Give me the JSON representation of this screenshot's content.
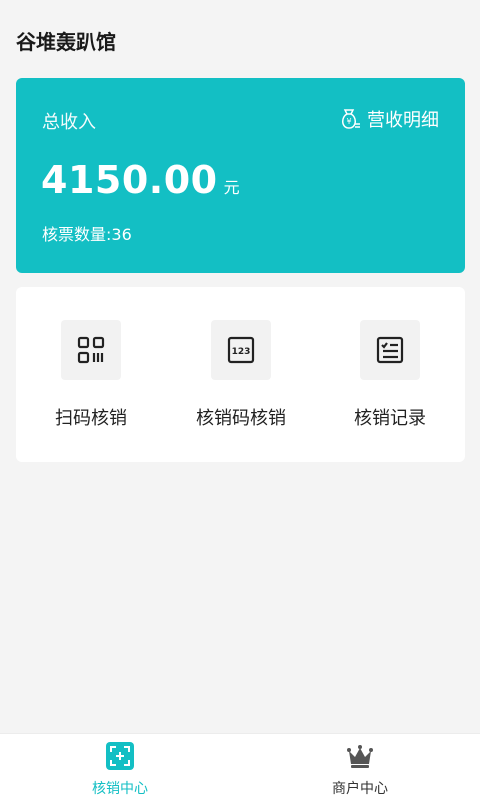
{
  "header": {
    "title": "谷堆轰趴馆"
  },
  "income": {
    "label": "总收入",
    "detail_label": "营收明细",
    "amount": "4150.00",
    "unit": "元",
    "count_text": "核票数量:36"
  },
  "actions": [
    {
      "label": "扫码核销",
      "icon": "qr-scan-icon"
    },
    {
      "label": "核销码核销",
      "icon": "number-code-icon"
    },
    {
      "label": "核销记录",
      "icon": "record-list-icon"
    }
  ],
  "tabbar": {
    "items": [
      {
        "label": "核销中心",
        "icon": "scan-frame-icon",
        "active": true
      },
      {
        "label": "商户中心",
        "icon": "crown-icon",
        "active": false
      }
    ]
  },
  "colors": {
    "accent": "#13bfc4",
    "background": "#f4f4f4",
    "inactive": "#333333"
  }
}
